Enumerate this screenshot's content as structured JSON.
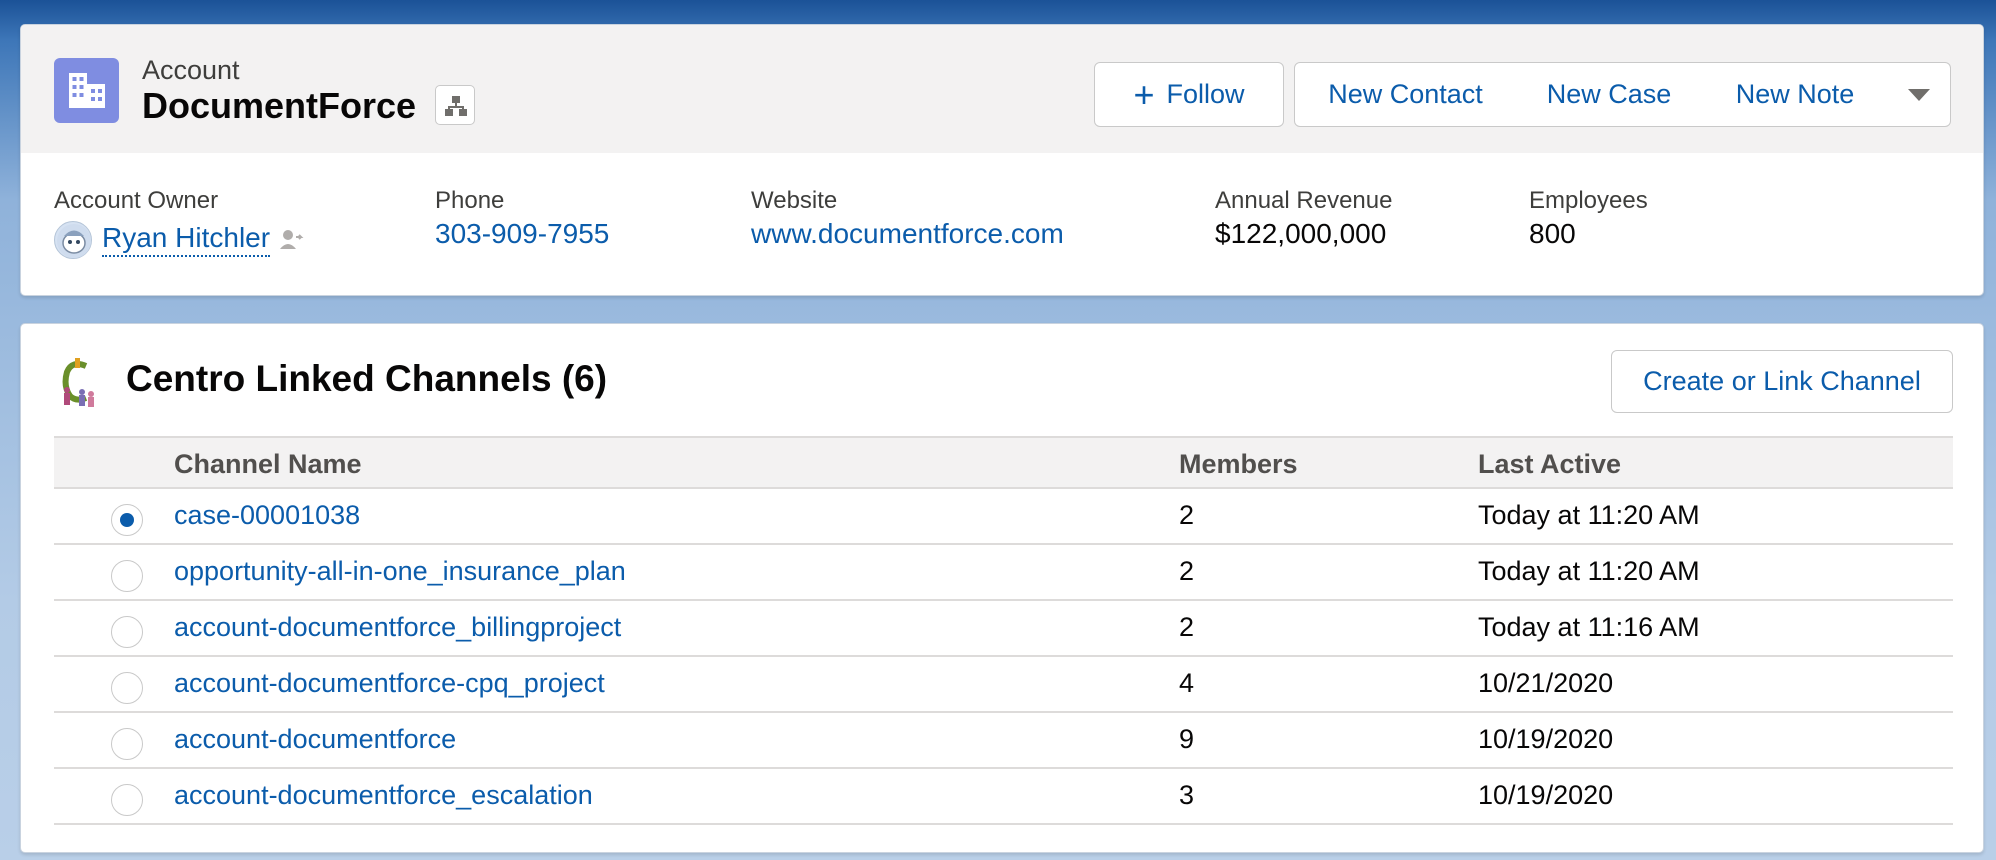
{
  "header": {
    "object_type": "Account",
    "record_name": "DocumentForce",
    "icon": "building-icon",
    "hierarchy_icon": "hierarchy-icon",
    "actions": {
      "follow_label": "Follow",
      "new_contact_label": "New Contact",
      "new_case_label": "New Case",
      "new_note_label": "New Note",
      "more_icon": "chevron-down-icon"
    },
    "fields": {
      "owner_label": "Account Owner",
      "owner_value": "Ryan Hitchler",
      "phone_label": "Phone",
      "phone_value": "303-909-7955",
      "website_label": "Website",
      "website_value": "www.documentforce.com",
      "revenue_label": "Annual Revenue",
      "revenue_value": "$122,000,000",
      "employees_label": "Employees",
      "employees_value": "800"
    }
  },
  "channels": {
    "title": "Centro Linked Channels (6)",
    "logo": "centro-logo",
    "create_button_label": "Create or Link Channel",
    "columns": {
      "name": "Channel Name",
      "members": "Members",
      "last_active": "Last Active"
    },
    "rows": [
      {
        "name": "case-00001038",
        "members": "2",
        "last_active": "Today at 11:20 AM",
        "selected": true
      },
      {
        "name": "opportunity-all-in-one_insurance_plan",
        "members": "2",
        "last_active": "Today at 11:20 AM",
        "selected": false
      },
      {
        "name": "account-documentforce_billingproject",
        "members": "2",
        "last_active": "Today at 11:16 AM",
        "selected": false
      },
      {
        "name": "account-documentforce-cpq_project",
        "members": "4",
        "last_active": "10/21/2020",
        "selected": false
      },
      {
        "name": "account-documentforce",
        "members": "9",
        "last_active": "10/19/2020",
        "selected": false
      },
      {
        "name": "account-documentforce_escalation",
        "members": "3",
        "last_active": "10/19/2020",
        "selected": false
      }
    ]
  },
  "colors": {
    "link": "#0b5cab",
    "account_icon": "#7f8de1",
    "header_bg": "#f3f2f2"
  }
}
